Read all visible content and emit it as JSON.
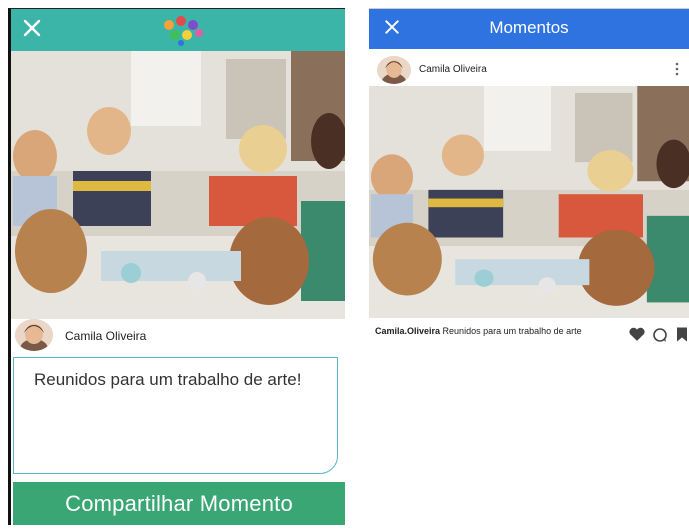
{
  "compose_screen": {
    "user_name": "Camila Oliveira",
    "post_text": "Reunidos para um trabalho de arte!",
    "share_label": "Compartilhar Momento"
  },
  "feed_screen": {
    "title": "Momentos",
    "user_name": "Camila Oliveira",
    "caption_user": "Camila.Oliveira",
    "caption_text": " Reunidos para um trabalho de arte"
  },
  "colors": {
    "compose_header": "#3ab5a8",
    "feed_header": "#2f73e0",
    "share_button": "#3aa674"
  },
  "icons": [
    "close-icon",
    "app-logo",
    "heart-icon",
    "comment-icon",
    "bookmark-icon",
    "more-vert-icon"
  ]
}
